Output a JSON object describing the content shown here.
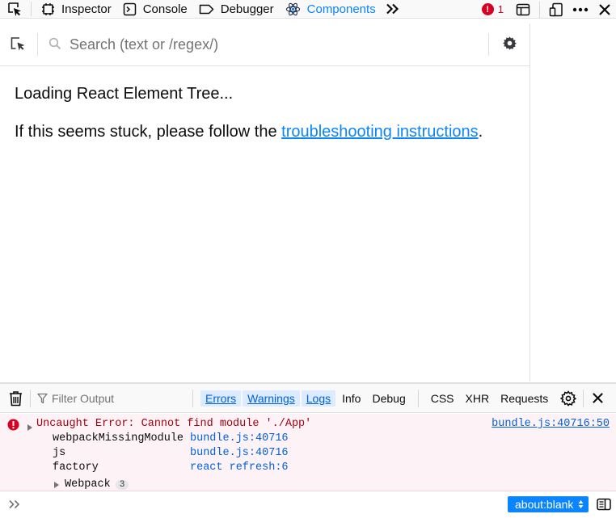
{
  "toolbox": {
    "tabs": [
      {
        "label": "Inspector",
        "icon": "inspector-icon"
      },
      {
        "label": "Console",
        "icon": "console-icon"
      },
      {
        "label": "Debugger",
        "icon": "debugger-icon"
      },
      {
        "label": "Components",
        "icon": "react-icon",
        "selected": true
      }
    ],
    "error_count": "1",
    "accent_color": "#0a84ff",
    "error_color": "#d70022"
  },
  "components": {
    "search_placeholder": "Search (text or /regex/)",
    "loading_text": "Loading React Element Tree...",
    "stuck_prefix": "If this seems stuck, please follow the ",
    "stuck_link": "troubleshooting instructions",
    "stuck_suffix": "."
  },
  "console": {
    "filter_placeholder": "Filter Output",
    "filters": [
      {
        "label": "Errors",
        "checked": true
      },
      {
        "label": "Warnings",
        "checked": true
      },
      {
        "label": "Logs",
        "checked": true
      },
      {
        "label": "Info",
        "checked": false
      },
      {
        "label": "Debug",
        "checked": false
      }
    ],
    "net_filters": [
      "CSS",
      "XHR",
      "Requests"
    ],
    "error": {
      "message": "Uncaught Error: Cannot find module './App'",
      "location": "bundle.js:40716:50",
      "frames": [
        {
          "fn": "webpackMissingModule",
          "loc": "bundle.js:40716"
        },
        {
          "fn": "js",
          "loc": "bundle.js:40716"
        },
        {
          "fn": "factory",
          "loc": "react refresh:6"
        }
      ],
      "group": {
        "label": "Webpack",
        "count": "3"
      }
    },
    "context": "about:blank"
  }
}
